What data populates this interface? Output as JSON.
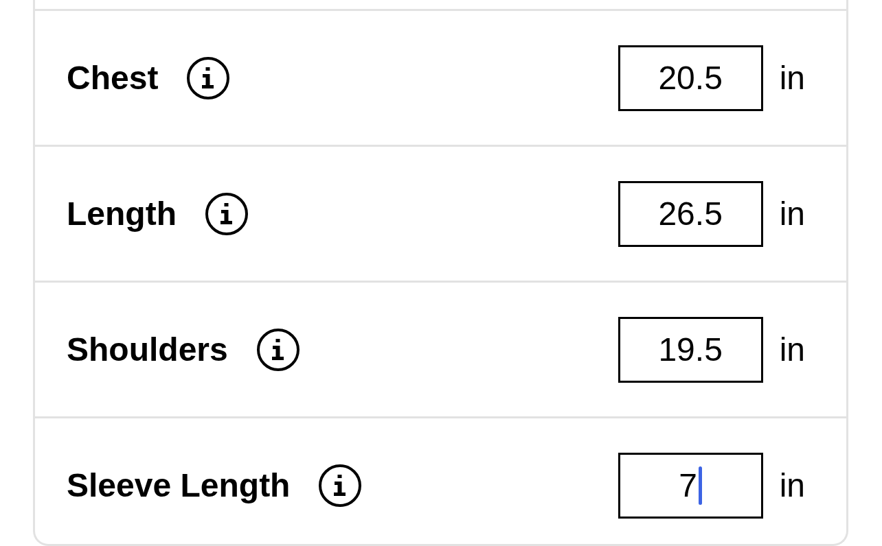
{
  "rows": [
    {
      "label": "Chest",
      "value": "20.5",
      "unit": "in",
      "focused": false
    },
    {
      "label": "Length",
      "value": "26.5",
      "unit": "in",
      "focused": false
    },
    {
      "label": "Shoulders",
      "value": "19.5",
      "unit": "in",
      "focused": false
    },
    {
      "label": "Sleeve Length",
      "value": "7",
      "unit": "in",
      "focused": true
    }
  ]
}
